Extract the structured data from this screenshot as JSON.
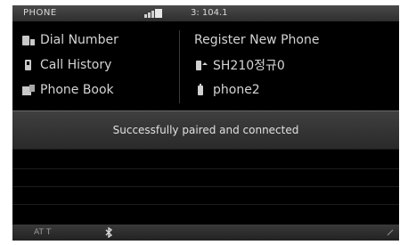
{
  "status": {
    "title": "PHONE",
    "frequency": "3: 104.1",
    "icons": {
      "signal": "signal-icon"
    }
  },
  "menu": {
    "left": [
      {
        "label": "Dial Number",
        "icon": "dial-icon"
      },
      {
        "label": "Call History",
        "icon": "call-history-icon"
      },
      {
        "label": "Phone Book",
        "icon": "phonebook-icon"
      }
    ],
    "right": [
      {
        "label": "Register New Phone",
        "icon": ""
      },
      {
        "label": "SH210정규0",
        "icon": "phone-connected-icon"
      },
      {
        "label": "phone2",
        "icon": "phone-icon"
      }
    ]
  },
  "popup": {
    "message": "Successfully paired and connected"
  },
  "bottom": {
    "left_label": "AT T",
    "bluetooth_icon": "bluetooth-icon"
  }
}
